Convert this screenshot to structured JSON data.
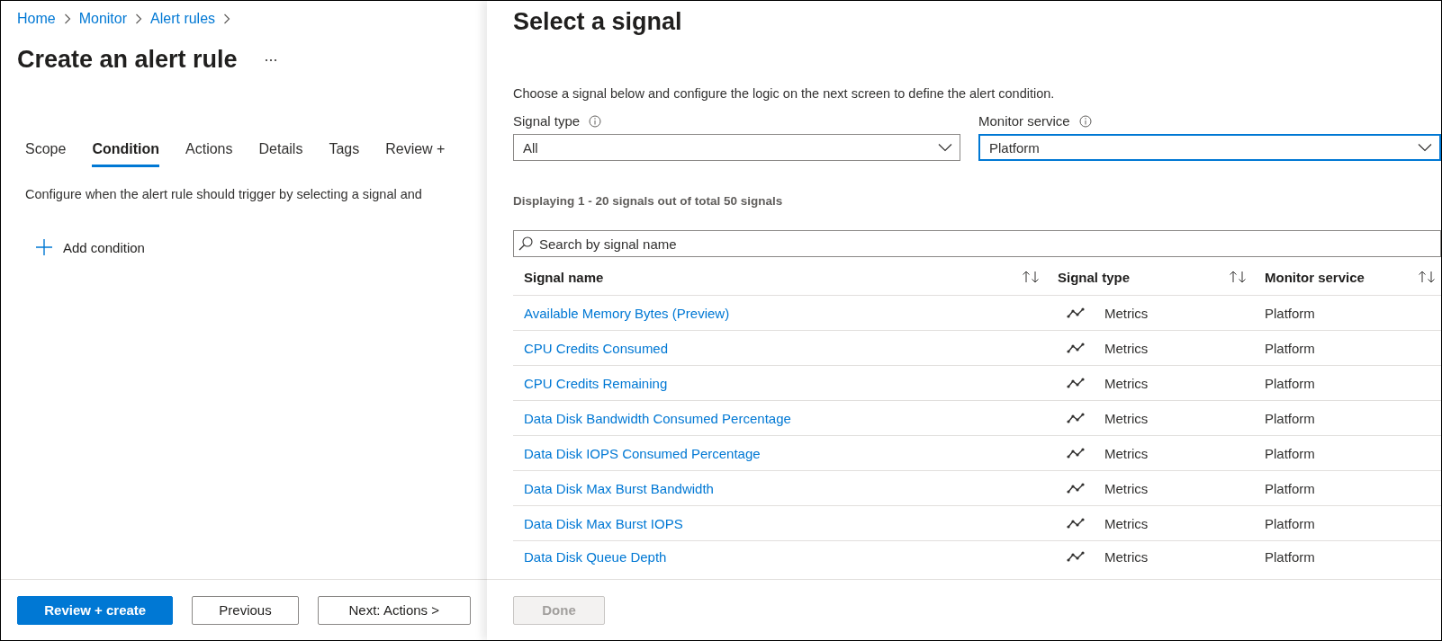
{
  "breadcrumb": [
    {
      "label": "Home"
    },
    {
      "label": "Monitor"
    },
    {
      "label": "Alert rules"
    }
  ],
  "page_title": "Create an alert rule",
  "tabs": [
    {
      "label": "Scope",
      "selected": false
    },
    {
      "label": "Condition",
      "selected": true
    },
    {
      "label": "Actions",
      "selected": false
    },
    {
      "label": "Details",
      "selected": false
    },
    {
      "label": "Tags",
      "selected": false
    },
    {
      "label": "Review +",
      "selected": false
    }
  ],
  "description": "Configure when the alert rule should trigger by selecting a signal and",
  "add_condition": "Add condition",
  "footer_buttons": [
    {
      "label": "Review + create",
      "kind": "primary"
    },
    {
      "label": "Previous",
      "kind": "secondary"
    },
    {
      "label": "Next: Actions >",
      "kind": "secondary"
    }
  ],
  "panel": {
    "title": "Select a signal",
    "description": "Choose a signal below and configure the logic on the next screen to define the alert condition.",
    "filters": [
      {
        "label": "Signal type",
        "value": "All",
        "focused": false
      },
      {
        "label": "Monitor service",
        "value": "Platform",
        "focused": true
      }
    ],
    "count": "Displaying 1 - 20 signals out of total 50 signals",
    "search": {
      "placeholder": "Search by signal name"
    },
    "columns": [
      "Signal name",
      "Signal type",
      "Monitor service"
    ],
    "rows": [
      {
        "name": "Available Memory Bytes (Preview)",
        "type": "Metrics",
        "service": "Platform"
      },
      {
        "name": "CPU Credits Consumed",
        "type": "Metrics",
        "service": "Platform"
      },
      {
        "name": "CPU Credits Remaining",
        "type": "Metrics",
        "service": "Platform"
      },
      {
        "name": "Data Disk Bandwidth Consumed Percentage",
        "type": "Metrics",
        "service": "Platform"
      },
      {
        "name": "Data Disk IOPS Consumed Percentage",
        "type": "Metrics",
        "service": "Platform"
      },
      {
        "name": "Data Disk Max Burst Bandwidth",
        "type": "Metrics",
        "service": "Platform"
      },
      {
        "name": "Data Disk Max Burst IOPS",
        "type": "Metrics",
        "service": "Platform"
      },
      {
        "name": "Data Disk Queue Depth",
        "type": "Metrics",
        "service": "Platform"
      }
    ],
    "done": {
      "label": "Done",
      "disabled": true
    }
  }
}
